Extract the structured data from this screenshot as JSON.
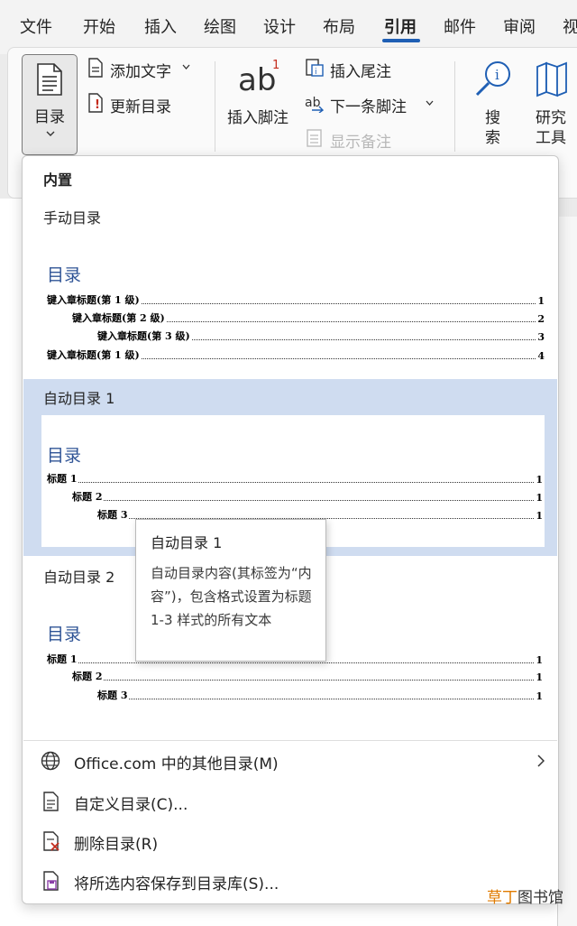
{
  "tabs": [
    "文件",
    "开始",
    "插入",
    "绘图",
    "设计",
    "布局",
    "引用",
    "邮件",
    "审阅",
    "视"
  ],
  "ribbon": {
    "toc_label": "目录",
    "add_text": "添加文字",
    "update_toc": "更新目录",
    "insert_footnote": "插入脚注",
    "insert_endnote": "插入尾注",
    "next_footnote": "下一条脚注",
    "show_notes": "显示备注",
    "search_top": "搜",
    "search_bottom": "索",
    "research_top": "研究",
    "research_bottom": "工具"
  },
  "menu": {
    "builtin_header": "内置",
    "manual": {
      "label": "手动目录",
      "title": "目录",
      "lines": [
        {
          "text": "键入章标题(第 1 级)",
          "page": "1"
        },
        {
          "text": "键入章标题(第 2 级)",
          "page": "2"
        },
        {
          "text": "键入章标题(第 3 级)",
          "page": "3"
        },
        {
          "text": "键入章标题(第 1 级)",
          "page": "4"
        }
      ]
    },
    "auto1": {
      "label": "自动目录 1",
      "title": "目录",
      "lines": [
        {
          "text": "标题 1",
          "page": "1"
        },
        {
          "text": "标题 2",
          "page": "1"
        },
        {
          "text": "标题 3",
          "page": "1"
        }
      ]
    },
    "auto2": {
      "label": "自动目录 2",
      "title": "目录",
      "lines": [
        {
          "text": "标题 1",
          "page": "1"
        },
        {
          "text": "标题 2",
          "page": "1"
        },
        {
          "text": "标题 3",
          "page": "1"
        }
      ]
    },
    "commands": {
      "more": "Office.com 中的其他目录(M)",
      "custom": "自定义目录(C)...",
      "remove": "删除目录(R)",
      "save": "将所选内容保存到目录库(S)..."
    }
  },
  "tooltip": {
    "title": "自动目录 1",
    "body": "自动目录内容(其标签为“内容”)，包含格式设置为标题 1-3 样式的所有文本"
  },
  "watermark": {
    "a": "草丁",
    "b": "图书馆"
  },
  "colors": {
    "accent": "#1f5fb4",
    "hover": "#cfdcf0",
    "toc_title": "#2f5496"
  }
}
